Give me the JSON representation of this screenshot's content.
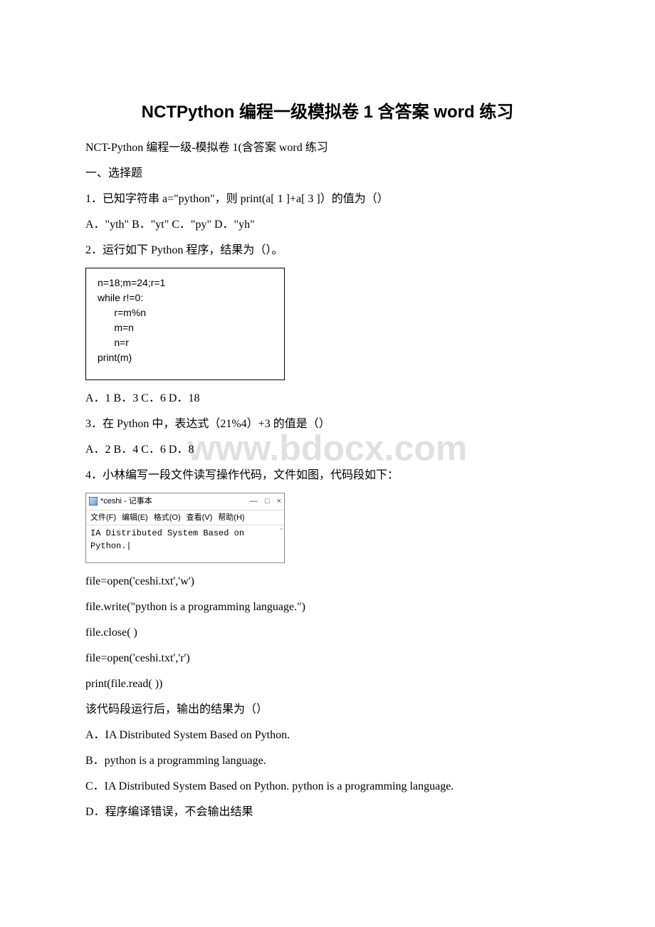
{
  "title": "NCTPython 编程一级模拟卷 1 含答案 word 练习",
  "subtitle": "NCT-Python 编程一级-模拟卷 1(含答案 word 练习",
  "section1": "一、选择题",
  "q1": "1．已知字符串 a=\"python\"，则 print(a[ 1 ]+a[ 3 ]）的值为（）",
  "q1opts": "A．\"yth\" B．\"yt\" C．\"py\" D．\"yh\"",
  "q2": "2．运行如下 Python 程序，结果为（）。",
  "q2code": "n=18;m=24;r=1\nwhile r!=0:\n      r=m%n\n      m=n\n      n=r\nprint(m)",
  "q2opts": "A．1 B．3 C．6 D．18",
  "q3": "3．在 Python 中，表达式（21%4）+3 的值是（）",
  "q3opts": "A．2 B．4 C．6 D．8",
  "q4": "4．小林编写一段文件读写操作代码，文件如图，代码段如下：",
  "notepad": {
    "title": "*ceshi - 记事本",
    "menu_file": "文件(F)",
    "menu_edit": "编辑(E)",
    "menu_format": "格式(O)",
    "menu_view": "查看(V)",
    "menu_help": "帮助(H)",
    "content": "IA Distributed System Based on Python.|",
    "min": "—",
    "max": "□",
    "close": "×",
    "scroll": "⌃"
  },
  "q4c1": "file=open('ceshi.txt','w')",
  "q4c2": "file.write(\"python is a programming language.\")",
  "q4c3": "file.close( )",
  "q4c4": "file=open('ceshi.txt','r')",
  "q4c5": "print(file.read( ))",
  "q4p": "该代码段运行后，输出的结果为（）",
  "q4a": "A．IA Distributed System Based on Python.",
  "q4b": "B．python is a programming language.",
  "q4cAns": "C．IA Distributed System Based on Python. python is a programming language.",
  "q4d": "D．程序编译错误，不会输出结果",
  "watermark": "www.bdocx.com"
}
